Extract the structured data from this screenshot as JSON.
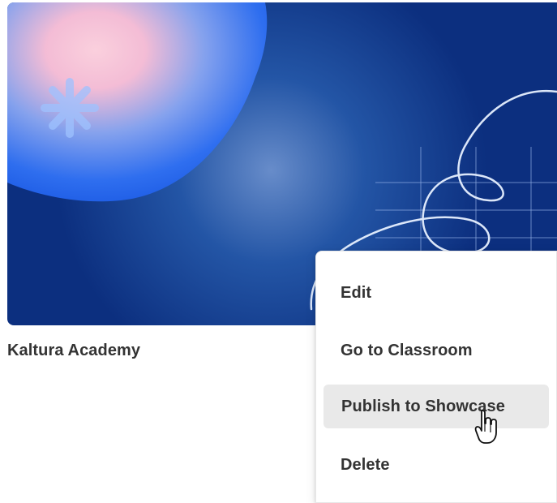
{
  "course": {
    "title": "Kaltura Academy"
  },
  "context_menu": {
    "items": [
      {
        "label": "Edit"
      },
      {
        "label": "Go to Classroom"
      },
      {
        "label": "Publish to Showcase",
        "state": "hovered"
      },
      {
        "label": "Delete"
      }
    ]
  },
  "icons": {
    "asterisk": "asterisk-icon",
    "cursor": "hand-pointer-cursor-icon"
  },
  "colors": {
    "thumbnail_blue": "#0f3f98",
    "menu_hover": "#e9e9e9",
    "text_primary": "#333333"
  }
}
